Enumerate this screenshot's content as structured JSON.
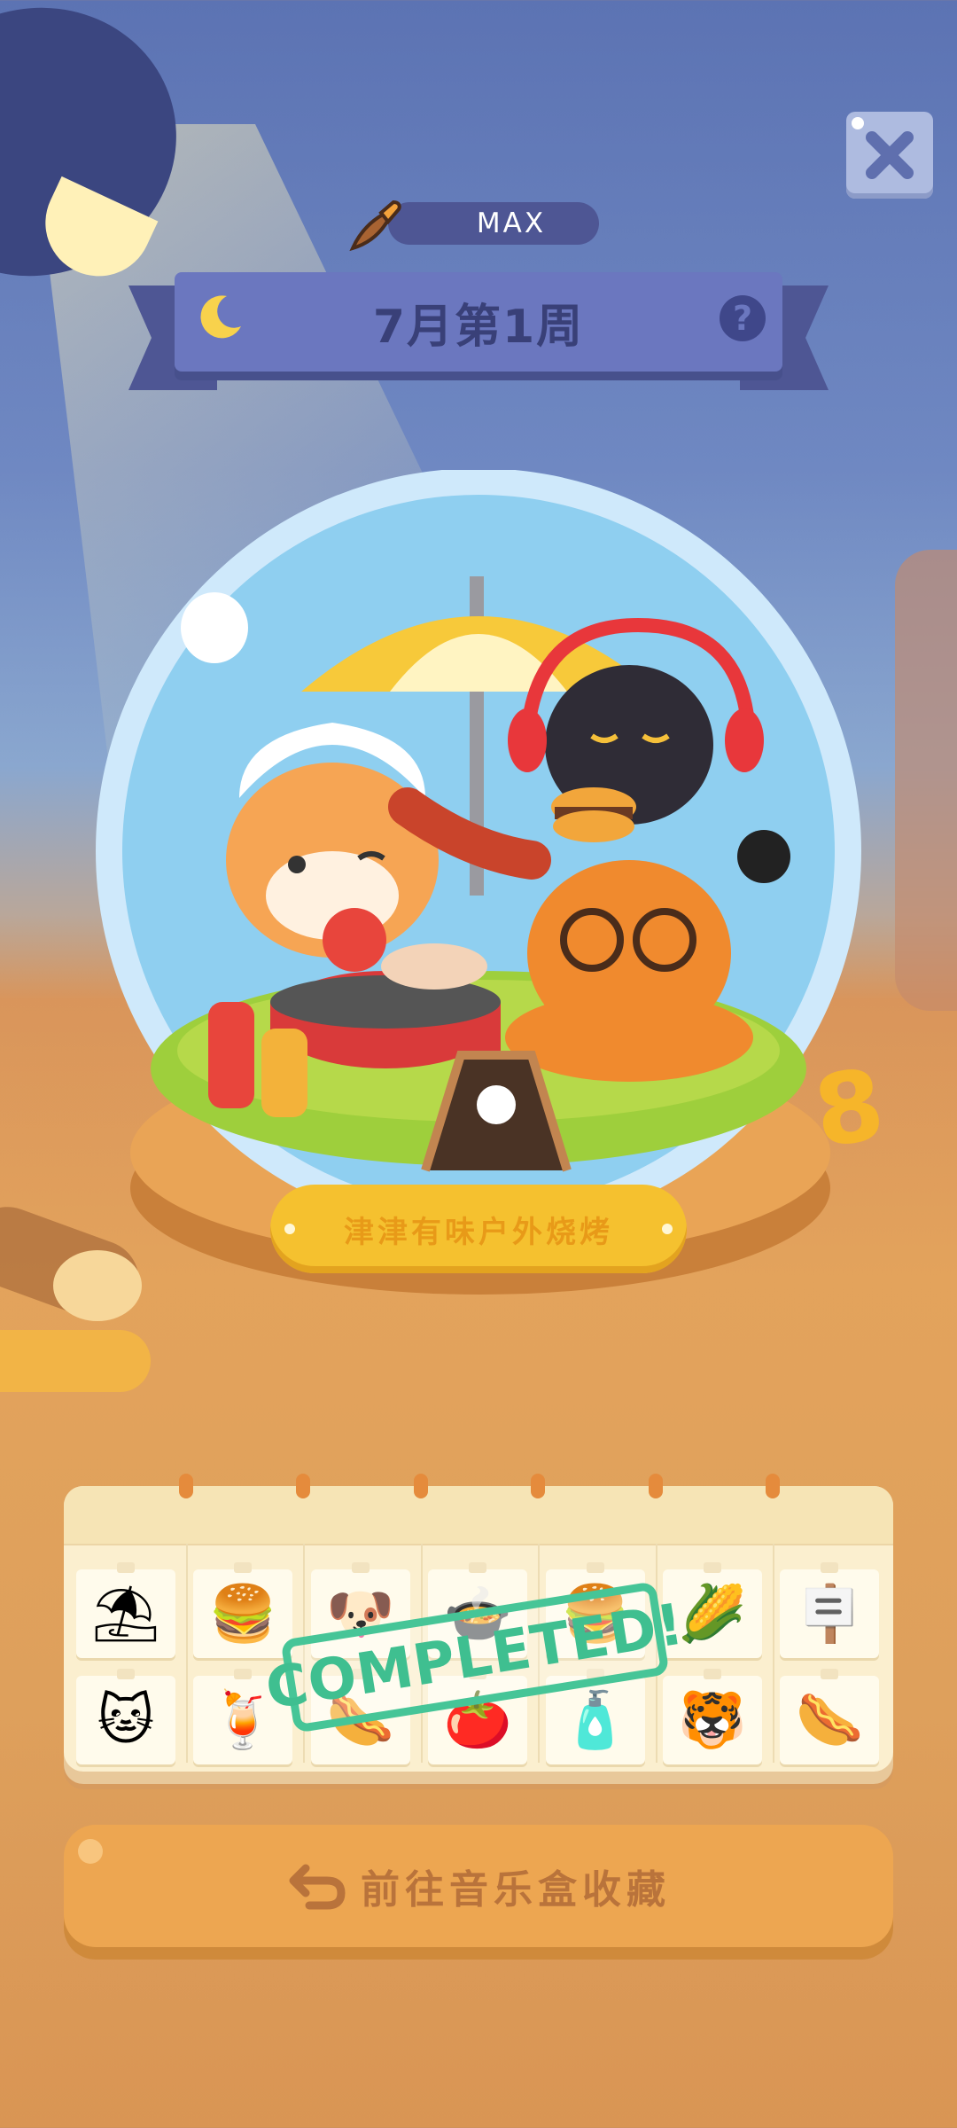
{
  "header": {
    "level_label": "MAX",
    "week_title": "7月第1周",
    "help_symbol": "?"
  },
  "close_button": {
    "icon": "close-icon"
  },
  "music_box": {
    "name": "津津有味户外烧烤",
    "badge_number": "8"
  },
  "collection": {
    "stamp_text": "COMPLETED!",
    "rows": [
      [
        "umbrella-icon",
        "burger-icon",
        "dog-chef-icon",
        "grill-icon",
        "burger-pixel-icon",
        "corn-icon",
        "sign-board-icon"
      ],
      [
        "black-cat-headphones-icon",
        "lemonade-icon",
        "sausage-icon",
        "tomato-icon",
        "sauce-bottles-icon",
        "orange-cat-icon",
        "hotdog-icon"
      ]
    ],
    "glyphs": [
      [
        "⛱",
        "🍔",
        "🐶",
        "🍲",
        "🍔",
        "🌽",
        "🪧"
      ],
      [
        "🐱",
        "🍹",
        "🌭",
        "🍅",
        "🧴",
        "🐯",
        "🌭"
      ]
    ]
  },
  "go_button": {
    "label": "前往音乐盒收藏",
    "icon": "return-arrow-icon"
  },
  "colors": {
    "ribbon": "#6b77bf",
    "stamp": "#46c597",
    "button": "#eda651",
    "plaque": "#f5c12f"
  }
}
